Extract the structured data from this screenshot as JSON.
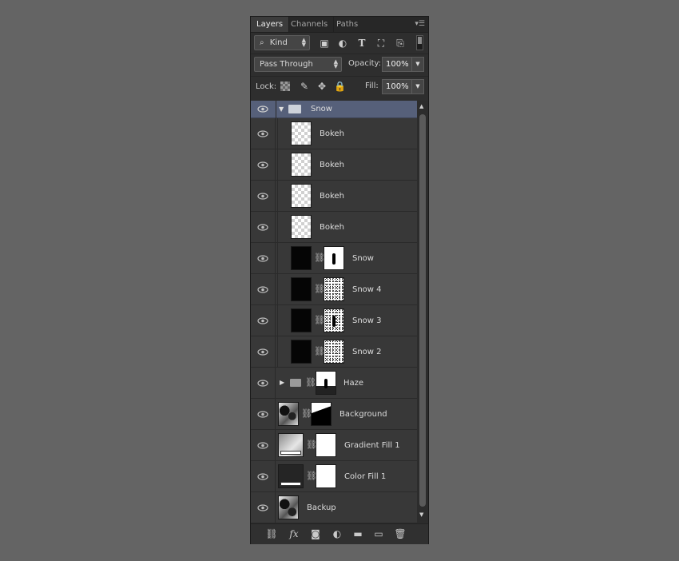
{
  "tabs": [
    {
      "label": "Layers"
    },
    {
      "label": "Channels"
    },
    {
      "label": "Paths"
    }
  ],
  "filter": {
    "kind": "Kind"
  },
  "blend": {
    "mode": "Pass Through",
    "opacity_label": "Opacity:",
    "opacity_value": "100%"
  },
  "lock": {
    "label": "Lock:",
    "fill_label": "Fill:",
    "fill_value": "100%"
  },
  "layers": [
    {
      "name": "Snow",
      "type": "group",
      "expanded": true,
      "selected": true
    },
    {
      "name": "Bokeh",
      "type": "pixel"
    },
    {
      "name": "Bokeh",
      "type": "pixel"
    },
    {
      "name": "Bokeh",
      "type": "pixel"
    },
    {
      "name": "Bokeh",
      "type": "pixel"
    },
    {
      "name": "Snow",
      "type": "masked"
    },
    {
      "name": "Snow 4",
      "type": "masked"
    },
    {
      "name": "Snow 3",
      "type": "masked"
    },
    {
      "name": "Snow 2",
      "type": "masked"
    },
    {
      "name": "Haze",
      "type": "group-masked",
      "expanded": false
    },
    {
      "name": "Background",
      "type": "masked"
    },
    {
      "name": "Gradient Fill 1",
      "type": "fill"
    },
    {
      "name": "Color Fill 1",
      "type": "fill"
    },
    {
      "name": "Backup",
      "type": "pixel"
    }
  ],
  "colors": {
    "selected": "#56607a",
    "panel": "#383838",
    "background": "#646464"
  }
}
